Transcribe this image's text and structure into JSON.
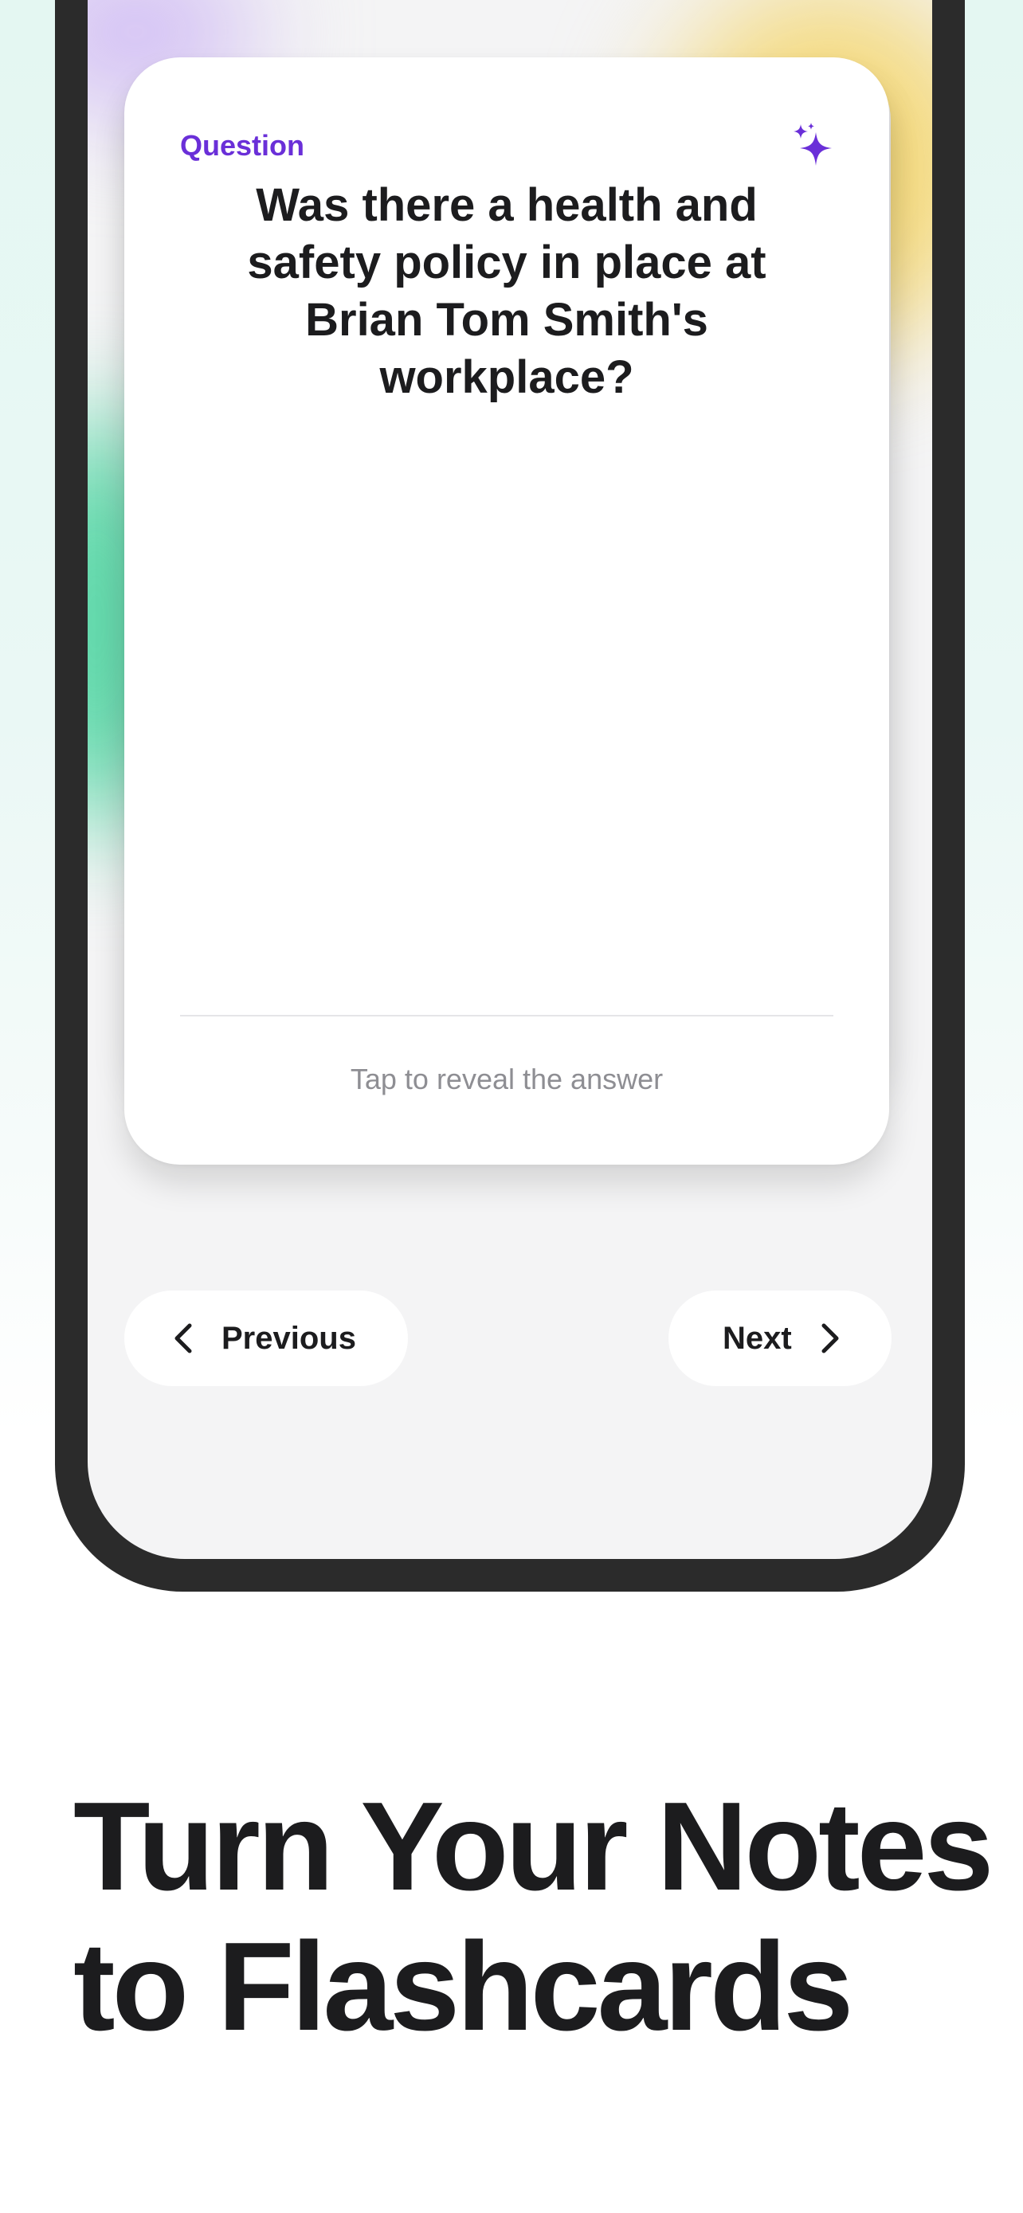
{
  "card": {
    "label": "Question",
    "question": "Was there a health and safety policy in place at Brian Tom Smith's workplace?",
    "reveal_hint": "Tap to reveal the answer",
    "icon": "sparkles-icon"
  },
  "navigation": {
    "previous_label": "Previous",
    "next_label": "Next"
  },
  "headline": {
    "line1": "Turn Your Notes",
    "line2": "to Flashcards"
  },
  "colors": {
    "accent": "#6a2fd8",
    "text": "#1c1c1e",
    "muted": "#8e8e93",
    "phone_frame": "#2b2b2b",
    "background_mint": "#e4f7f2"
  }
}
